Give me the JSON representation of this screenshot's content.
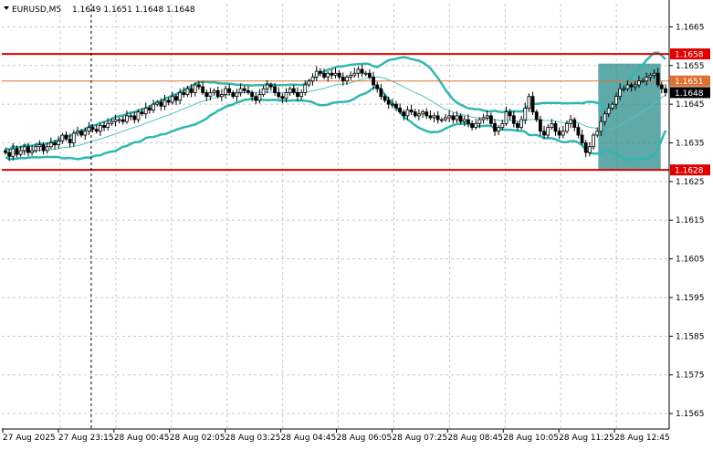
{
  "header": {
    "symbol_label": "EURUSD,M5",
    "ohlc_label": "1.1649 1.1651 1.1648 1.1648"
  },
  "colors": {
    "background": "#ffffff",
    "grid": "#c8c8c8",
    "candle": "#000000",
    "bollinger": "#2fb8b0",
    "middle_band": "#4fc4bc",
    "level_line": "#e00000",
    "price_line": "#e07030",
    "highlight_box": "#2a8c8c",
    "current_price_box": "#000000"
  },
  "chart_data": {
    "type": "candlestick",
    "symbol": "EURUSD",
    "timeframe": "M5",
    "y_range": [
      1.1561,
      1.1671
    ],
    "y_ticks": [
      "1.1665",
      "1.1655",
      "1.1645",
      "1.1635",
      "1.1625",
      "1.1615",
      "1.1605",
      "1.1595",
      "1.1585",
      "1.1575",
      "1.1565"
    ],
    "x_ticks": [
      "27 Aug 2025",
      "27 Aug 23:15",
      "28 Aug 00:45",
      "28 Aug 02:05",
      "28 Aug 03:25",
      "28 Aug 04:45",
      "28 Aug 06:05",
      "28 Aug 07:25",
      "28 Aug 08:45",
      "28 Aug 10:05",
      "28 Aug 11:25",
      "28 Aug 12:45"
    ],
    "levels": [
      {
        "label": "1.1658",
        "value": 1.1658,
        "style": "resistance"
      },
      {
        "label": "1.1628",
        "value": 1.1628,
        "style": "support"
      }
    ],
    "price_line": {
      "label": "1.1651",
      "value": 1.1651
    },
    "current_price": {
      "label": "1.1648",
      "value": 1.1648
    },
    "vertical_marker_tick": 1,
    "highlight_zone": {
      "from_index": 157,
      "to_index": 172,
      "low": 1.1628,
      "high": 1.16555
    },
    "closes": [
      1.16325,
      1.16315,
      1.16335,
      1.1632,
      1.1633,
      1.1634,
      1.16325,
      1.1633,
      1.1634,
      1.16345,
      1.1633,
      1.1634,
      1.1635,
      1.16345,
      1.16355,
      1.1637,
      1.1636,
      1.1635,
      1.16375,
      1.1638,
      1.1637,
      1.1638,
      1.1639,
      1.16385,
      1.1638,
      1.16395,
      1.1639,
      1.164,
      1.16405,
      1.1641,
      1.1641,
      1.16405,
      1.1642,
      1.1642,
      1.1641,
      1.1643,
      1.16425,
      1.1644,
      1.16435,
      1.1645,
      1.16455,
      1.16445,
      1.1646,
      1.16455,
      1.1647,
      1.1646,
      1.1648,
      1.16475,
      1.1649,
      1.1648,
      1.165,
      1.16495,
      1.1648,
      1.1647,
      1.1648,
      1.16485,
      1.1647,
      1.16475,
      1.1649,
      1.1648,
      1.1647,
      1.1648,
      1.1649,
      1.16485,
      1.1648,
      1.1647,
      1.1646,
      1.16475,
      1.1649,
      1.165,
      1.16495,
      1.1648,
      1.1647,
      1.16465,
      1.1648,
      1.1649,
      1.1648,
      1.1647,
      1.1648,
      1.165,
      1.1651,
      1.1652,
      1.16535,
      1.1653,
      1.1652,
      1.1653,
      1.16525,
      1.1653,
      1.1652,
      1.1651,
      1.1652,
      1.16525,
      1.1653,
      1.1654,
      1.1653,
      1.1653,
      1.1652,
      1.165,
      1.1649,
      1.1647,
      1.1646,
      1.1645,
      1.1645,
      1.1644,
      1.1643,
      1.1642,
      1.16435,
      1.1643,
      1.1642,
      1.16425,
      1.1643,
      1.1642,
      1.16415,
      1.1642,
      1.1641,
      1.1641,
      1.16415,
      1.1642,
      1.1641,
      1.1642,
      1.16405,
      1.1641,
      1.164,
      1.1639,
      1.164,
      1.1641,
      1.16415,
      1.1642,
      1.164,
      1.1638,
      1.1639,
      1.164,
      1.1643,
      1.1642,
      1.164,
      1.1639,
      1.1641,
      1.1644,
      1.1647,
      1.1643,
      1.1641,
      1.1638,
      1.1637,
      1.1639,
      1.164,
      1.1638,
      1.1637,
      1.1638,
      1.164,
      1.1641,
      1.1639,
      1.1637,
      1.1635,
      1.16325,
      1.1634,
      1.1637,
      1.1638,
      1.16405,
      1.16425,
      1.1644,
      1.1645,
      1.1647,
      1.1649,
      1.1649,
      1.165,
      1.16495,
      1.165,
      1.1651,
      1.1651,
      1.1652,
      1.16525,
      1.1653,
      1.165,
      1.1649,
      1.1648
    ]
  }
}
